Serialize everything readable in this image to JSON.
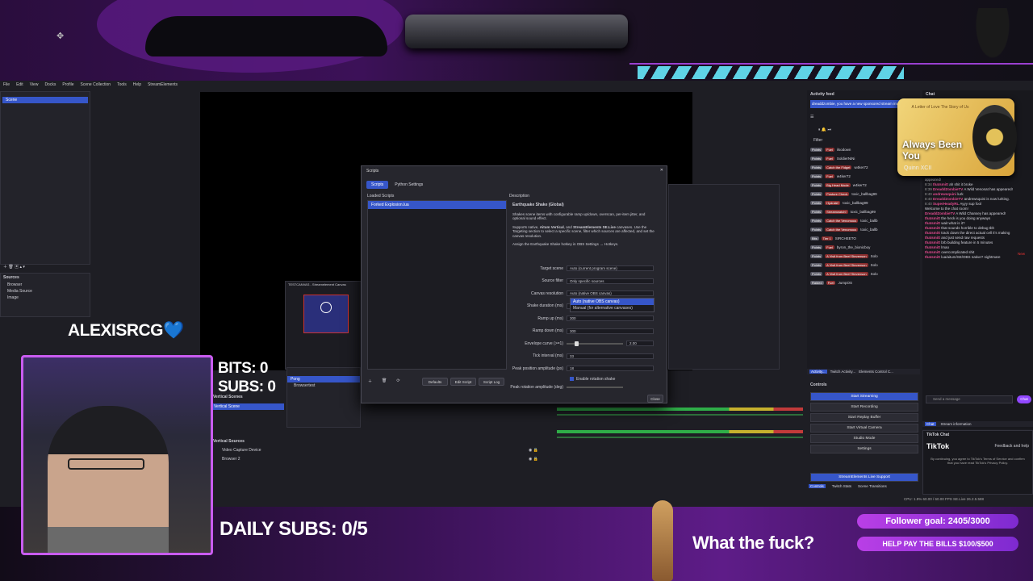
{
  "overlay": {
    "streamer_name": "ALEXISRCG",
    "heart": "💙",
    "bits": "BITS: 0",
    "subs": "SUBS: 0",
    "daily_subs": "DAILY SUBS: 0/5",
    "caption": "What the fuck?",
    "follower_goal": "Follower goal: 2405/3000",
    "bills": "HELP PAY THE BILLS $100/$500"
  },
  "obs": {
    "menu": [
      "File",
      "Edit",
      "View",
      "Docks",
      "Profile",
      "Scene Collection",
      "Tools",
      "Help",
      "StreamElements"
    ],
    "scenes_item": "Scene",
    "sources_header": "Sources",
    "sources": [
      "Browser",
      "Media Source",
      "Image"
    ],
    "vertical_scenes_header": "Vertical Scenes",
    "vertical_scene": "Vertical Scene",
    "vertical_sources_header": "Vertical Sources",
    "vertical_sources": [
      "Video Capture Device",
      "Browser 2"
    ],
    "testcanvas_title": "TESTCANVAS - Streamelement Canvas",
    "scenes_mini": [
      "Pong",
      "Browsertest"
    ]
  },
  "scripts_dialog": {
    "title": "Scripts",
    "tabs": [
      "Scripts",
      "Python Settings"
    ],
    "loaded_scripts_label": "Loaded Scripts",
    "loaded_script": "Forked Explosion.lua",
    "description_label": "Description",
    "desc_title": "Earthquake Shake (Global)",
    "desc_p1": "Shakes scene items with configurable ramp up/down, overscan, per-item jitter, and optional sound effect.",
    "desc_p2_pre": "Supports native, ",
    "desc_p2_b1": "Aitum Vertical",
    "desc_p2_mid": ", and ",
    "desc_p2_b2": "StreamElements SE.Live",
    "desc_p2_post": " canvases. Use the Targeting section to select a specific scene, filter which sources are affected, and set the canvas resolution.",
    "desc_p3": "Assign the Earthquake Shake hotkey in OBS Settings → Hotkeys.",
    "fields": [
      {
        "label": "Target scene",
        "value": "Auto (current program scene)"
      },
      {
        "label": "Source filter",
        "value": "Only specific sources"
      },
      {
        "label": "Canvas resolution",
        "value": "Auto (native OBS canvas)"
      },
      {
        "label": "Shake duration (ms)",
        "value": ""
      },
      {
        "label": "Ramp up (ms)",
        "value": "300"
      },
      {
        "label": "Ramp down (ms)",
        "value": "300"
      },
      {
        "label": "Envelope curve (>=1)",
        "value": "2.00"
      },
      {
        "label": "Tick interval (ms)",
        "value": "33"
      },
      {
        "label": "Peak position amplitude (px)",
        "value": "18"
      }
    ],
    "dropdown_options": [
      "Auto (native OBS canvas)",
      "Manual (for alternative canvases)"
    ],
    "checkbox_label": "Enable rotation shake",
    "peak_rotation_label": "Peak rotation amplitude (deg)",
    "buttons": [
      "Defaults",
      "Edit Script",
      "Script Log"
    ],
    "close": "Close"
  },
  "activity_feed": {
    "title": "Activity feed",
    "banner": "dreaddzombie, you have a new sponsored stream invitation!",
    "filter": "Filter",
    "rows": [
      {
        "badge": "Points",
        "tag": "Fuel",
        "user": "ilsodown"
      },
      {
        "badge": "Points",
        "tag": "Fuel",
        "user": "SoldierNiNi"
      },
      {
        "badge": "Points",
        "tag": "Catch the Fidget",
        "user": "w4ker72"
      },
      {
        "badge": "Points",
        "tag": "Fuel",
        "user": "w4ker72"
      },
      {
        "badge": "Points",
        "tag": "Big Head Mode",
        "user": "w4ker72"
      },
      {
        "badge": "Points",
        "tag": "Posture Check",
        "user": "toxic_ballbag99"
      },
      {
        "badge": "Points",
        "tag": "Hydrate!",
        "user": "toxic_ballbag99"
      },
      {
        "badge": "Points",
        "tag": "Streamwatch!",
        "user": "toxic_ballbag99"
      },
      {
        "badge": "Points",
        "tag": "Catch the Venomous",
        "user": "toxic_ballb"
      },
      {
        "badge": "Points",
        "tag": "Catch the Venomous",
        "user": "toxic_ballb"
      },
      {
        "badge": "Bits",
        "tag": "Tier 1",
        "user": "SIRCHEETO"
      },
      {
        "badge": "Points",
        "tag": "Fuel",
        "user": "byron_the_bionicboy"
      },
      {
        "badge": "Points",
        "tag": "A Visit from Beef Stevenson",
        "user": "Solo"
      },
      {
        "badge": "Points",
        "tag": "A Visit from Beef Stevenson",
        "user": "Solo"
      },
      {
        "badge": "Points",
        "tag": "A Visit from Beef Stevenson",
        "user": "Solo"
      },
      {
        "badge": "Raided",
        "tag": "Fuel",
        "user": "JumpOS"
      }
    ],
    "tabs": [
      "Activity...",
      "Twitch Activity...",
      "Elements Control C..."
    ]
  },
  "now_playing": {
    "title": "Always Been You",
    "artist": "Quinn XCII",
    "album_caption": "A Letter of Love The Story of Us"
  },
  "chat": {
    "title": "Chat",
    "lines": [
      {
        "t": "",
        "u": "",
        "m": "appeared!"
      },
      {
        "t": "8:34",
        "u": "thatsmitt",
        "m": "ah shit it broke"
      },
      {
        "t": "8:39",
        "u": "DreaddZombieTV",
        "m": "A Wild Venonat has appeared!"
      },
      {
        "t": "8:40",
        "u": "andrewsquini",
        "m": "lurk"
      },
      {
        "t": "8:40",
        "u": "DreaddZombieTV",
        "m": "andrewsquini is now lurking."
      },
      {
        "t": "8:40",
        "u": "SuperHeadyRL",
        "m": "Ayyy sup fool"
      },
      {
        "t": "",
        "u": "",
        "m": "Welcome to the chat room!"
      },
      {
        "t": "",
        "u": "DreaddZombieTV",
        "m": "A Wild Chansey has appeared!"
      },
      {
        "t": "",
        "u": "thatsmitt",
        "m": "the heck is you doing anyways"
      },
      {
        "t": "",
        "u": "thatsmitt",
        "m": "wait what is it?"
      },
      {
        "t": "",
        "u": "thatsmitt",
        "m": "that sounds horrible to debug tbh"
      },
      {
        "t": "",
        "u": "thatsmitt",
        "m": "track down the direct actual cell it's making"
      },
      {
        "t": "",
        "u": "thatsmitt",
        "m": "and just send raw requests"
      },
      {
        "t": "",
        "u": "thatsmitt",
        "m": "brb building feature in 5 minutes"
      },
      {
        "t": "",
        "u": "thatsmitt",
        "m": "lmao"
      },
      {
        "t": "",
        "u": "thatsmitt",
        "m": "overcomplicated shit"
      },
      {
        "t": "",
        "u": "thatsmitt",
        "m": "lua/aitum/SE/OBS native? nightmare"
      }
    ],
    "input_placeholder": "Send a message",
    "chat_button": "Chat",
    "tabs": [
      "Chat",
      "Stream information"
    ],
    "new_label": "New"
  },
  "tiktok": {
    "header": "TikTok Chat",
    "brand": "TikTok",
    "feedback": "Feedback and help",
    "note": "By continuing, you agree to TikTok's Terms of Service and confirm that you have read TikTok's Privacy Policy."
  },
  "controls": {
    "header": "Controls",
    "buttons": [
      "Start Streaming",
      "Start Recording",
      "Start Replay Buffer",
      "Start Virtual Camera",
      "Studio Mode",
      "Settings"
    ],
    "se_support": "StreamElements Live Support",
    "tabs": [
      "Controls",
      "Twitch Stats",
      "Scene Transitions"
    ]
  },
  "status_bar": "CPU: 1.9%   60.00 / 60.00 FPS   SE.Live 26.2.5.588",
  "colors": {
    "accent": "#3656c9",
    "purple": "#9a3fd0",
    "cyan": "#5fd3e6"
  }
}
